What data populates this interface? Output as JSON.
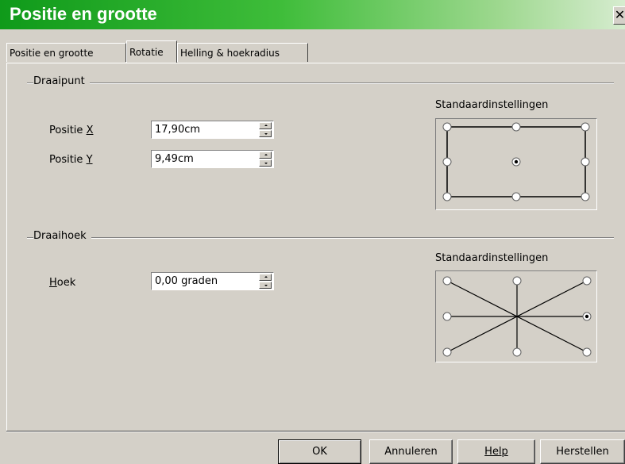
{
  "window": {
    "title": "Positie en grootte"
  },
  "tabs": [
    {
      "label": "Positie en grootte",
      "active": false
    },
    {
      "label": "Rotatie",
      "active": true
    },
    {
      "label": "Helling & hoekradius",
      "active": false
    }
  ],
  "pivot": {
    "title": "Draaipunt",
    "pos_x": {
      "label_pre": "Positie ",
      "label_key": "X",
      "value": "17,90cm"
    },
    "pos_y": {
      "label_pre": "Positie ",
      "label_key": "Y",
      "value": "9,49cm"
    },
    "preset_label": "Standaardinstellingen",
    "selected_point": "center"
  },
  "angle": {
    "title": "Draaihoek",
    "label_key": "H",
    "label_rest": "oek",
    "value": "0,00 graden",
    "preset_label": "Standaardinstellingen",
    "selected_point": "right"
  },
  "buttons": {
    "ok": "OK",
    "cancel": "Annuleren",
    "help": "Help",
    "reset": "Herstellen"
  }
}
